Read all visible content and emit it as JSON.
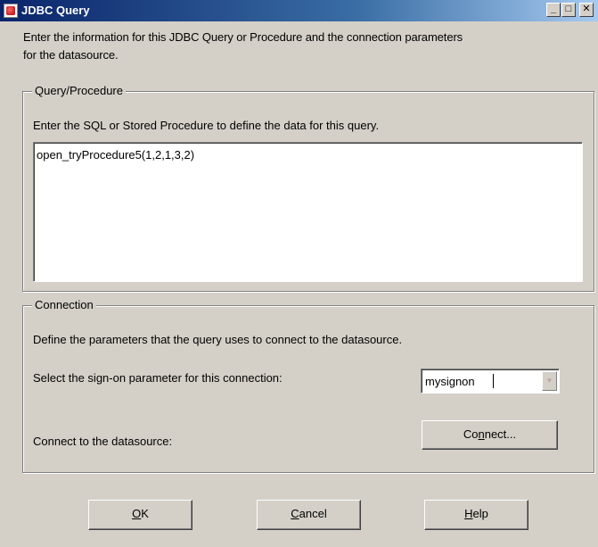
{
  "window": {
    "title": "JDBC Query",
    "minimize_glyph": "_",
    "maximize_glyph": "□",
    "close_glyph": "✕"
  },
  "intro": {
    "line1": "Enter the information for this JDBC Query or Procedure and the connection parameters",
    "line2": "for the datasource."
  },
  "query_group": {
    "title": "Query/Procedure",
    "description": "Enter the SQL or Stored Procedure to define the data for this query.",
    "sql_value": "open_tryProcedure5(1,2,1,3,2)"
  },
  "connection_group": {
    "title": "Connection",
    "description": "Define the parameters that the query uses to connect to the datasource.",
    "signon_label": "Select the sign-on parameter for this connection:",
    "signon_value": "mysignon",
    "connect_label": "Connect to the datasource:",
    "connect_button": {
      "before": "Co",
      "mnemonic": "n",
      "after": "nect..."
    }
  },
  "buttons": {
    "ok": {
      "mnemonic": "O",
      "rest": "K"
    },
    "cancel": {
      "mnemonic": "C",
      "rest": "ancel"
    },
    "help": {
      "mnemonic": "H",
      "rest": "elp"
    }
  },
  "colors": {
    "titlebar_start": "#0a246a",
    "titlebar_end": "#a6caf0",
    "dialog_bg": "#d4d0c8"
  },
  "icons": {
    "app": "java-cup-icon",
    "combo": "chevron-down-icon"
  }
}
